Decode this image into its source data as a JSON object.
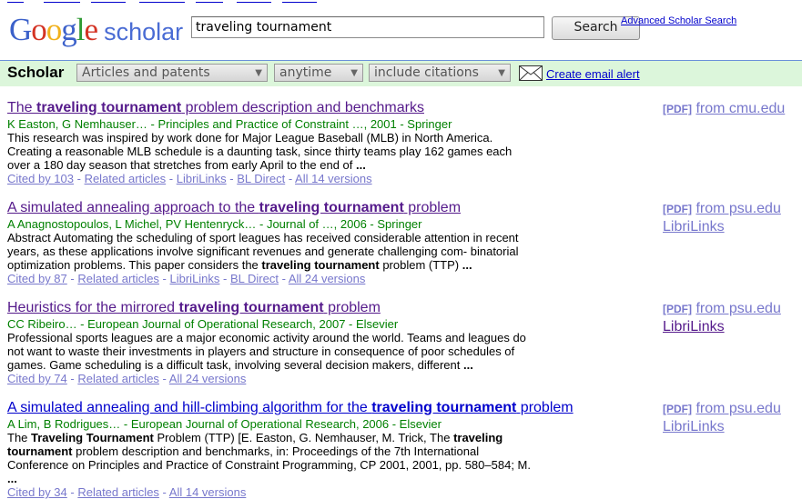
{
  "header": {
    "logo_google": [
      "G",
      "o",
      "o",
      "g",
      "l",
      "e"
    ],
    "logo_google_colors": [
      "#3c61ca",
      "#d43425",
      "#f1b11c",
      "#3c61ca",
      "#2f9a33",
      "#d43425"
    ],
    "logo_scholar": "scholar",
    "search_value": "traveling tournament",
    "search_button": "Search",
    "advanced_link": "Advanced Scholar Search"
  },
  "bar": {
    "title": "Scholar",
    "scope_select": "Articles and patents",
    "time_select": "anytime",
    "citations_select": "include citations",
    "email_alert": "Create email alert"
  },
  "results": [
    {
      "title_pre": "The ",
      "title_bold": "traveling tournament",
      "title_post": " problem description and benchmarks",
      "authors": "K Easton, G Nemhauser… - Principles and Practice of Constraint …, 2001 - Springer",
      "snippet": "This research was inspired by work done for Major League Baseball (MLB) in North America. Creating a reasonable MLB schedule is a daunting task, since thirty teams play 162 games each over a 180 day season that stretches from early April to the end of ",
      "snippet_end": "...",
      "links": [
        "Cited by 103",
        "Related articles",
        "LibriLinks",
        "BL Direct",
        "All 14 versions"
      ],
      "pdf": "[PDF]",
      "source": "from cmu.edu",
      "libri": ""
    },
    {
      "title_pre": "A simulated annealing approach to the ",
      "title_bold": "traveling tournament",
      "title_post": " problem",
      "authors": "A Anagnostopoulos, L Michel, PV Hentenryck… - Journal of …, 2006 - Springer",
      "snippet_a": "Abstract Automating the scheduling of sport leagues has received considerable attention in recent years, as these applications involve significant revenues and generate challenging com- binatorial optimization problems. This paper considers the ",
      "snippet_bold": "traveling tournament",
      "snippet_b": " problem (TTP) ",
      "snippet_end": "...",
      "links": [
        "Cited by 87",
        "Related articles",
        "LibriLinks",
        "BL Direct",
        "All 24 versions"
      ],
      "pdf": "[PDF]",
      "source": "from psu.edu",
      "libri": "LibriLinks"
    },
    {
      "title_pre": "Heuristics for the mirrored ",
      "title_bold": "traveling tournament",
      "title_post": " problem",
      "authors": "CC Ribeiro… - European Journal of Operational Research, 2007 - Elsevier",
      "snippet": "Professional sports leagues are a major economic activity around the world. Teams and leagues do not want to waste their investments in players and structure in consequence of poor schedules of games. Game scheduling is a difficult task, involving several decision makers, different ",
      "snippet_end": "...",
      "links": [
        "Cited by 74",
        "Related articles",
        "All 24 versions"
      ],
      "pdf": "[PDF]",
      "source": "from psu.edu",
      "libri": "LibriLinks"
    },
    {
      "title_pre": "A simulated annealing and hill-climbing algorithm for the ",
      "title_bold": "traveling tournament",
      "title_post": " problem",
      "authors": "A Lim, B Rodrigues… - European Journal of Operational Research, 2006 - Elsevier",
      "snippet_p1": "The ",
      "snippet_b1": "Traveling Tournament",
      "snippet_p2": " Problem (TTP) [E. Easton, G. Nemhauser, M. Trick, The ",
      "snippet_b2": "traveling tournament",
      "snippet_p3": " problem description and benchmarks, in: Proceedings of the 7th International Conference on Principles and Practice of Constraint Programming, CP 2001, 2001, pp. 580–584; M. ",
      "snippet_end": "...",
      "links": [
        "Cited by 34",
        "Related articles",
        "All 14 versions"
      ],
      "pdf": "[PDF]",
      "source": "from psu.edu",
      "libri": "LibriLinks"
    }
  ],
  "colors": {
    "bar_bg": "#dcf6db",
    "link": "#0000cc",
    "visited": "#551a8b",
    "green": "#008000",
    "muted_link": "#7777cc"
  },
  "icons": {
    "email": "envelope-icon",
    "dropdown": "chevron-down-icon"
  }
}
